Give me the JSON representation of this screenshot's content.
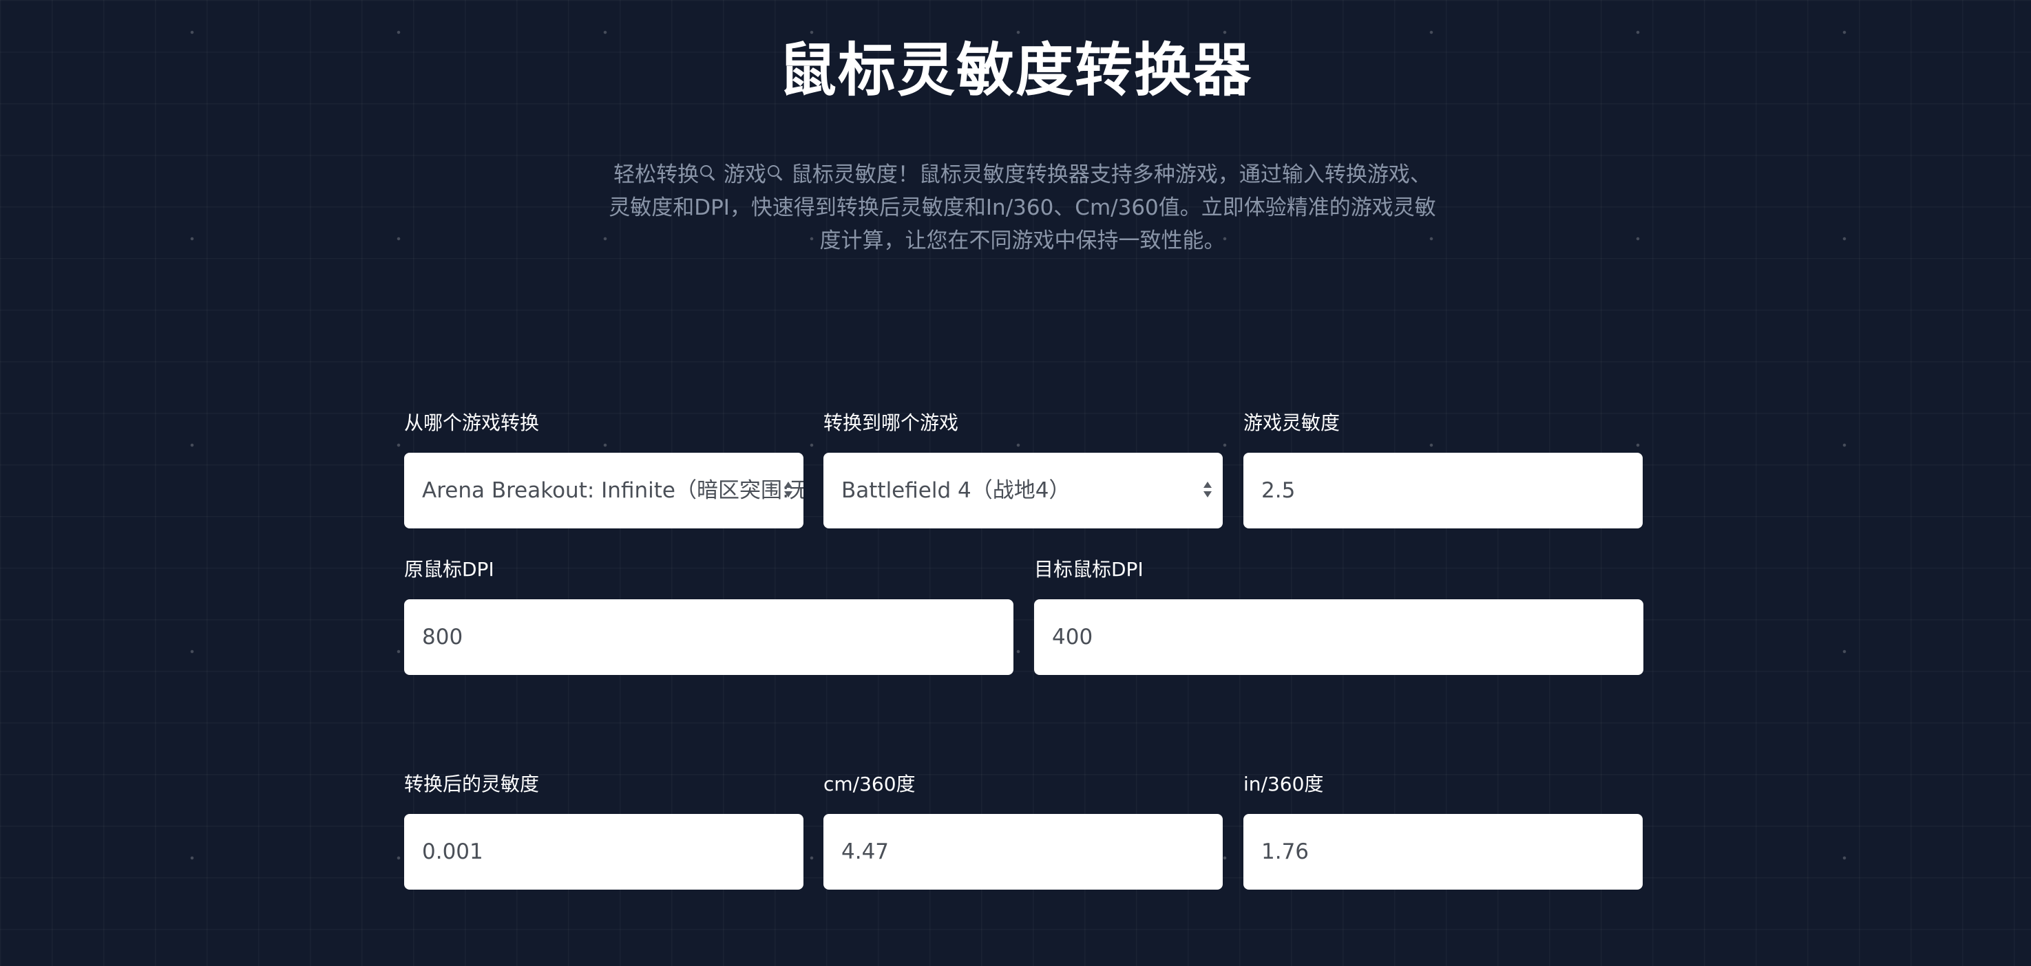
{
  "header": {
    "title": "鼠标灵敏度转换器",
    "description_parts": [
      "轻松转换",
      " 游戏",
      " 鼠标灵敏度！鼠标灵敏度转换器支持多种游戏，通过输入转换游戏、灵敏度和DPI，快速得到转换后灵敏度和In/360、Cm/360值。立即体验精准的游戏灵敏度计算，让您在不同游戏中保持一致性能。"
    ]
  },
  "form": {
    "from_game": {
      "label": "从哪个游戏转换",
      "value": "Arena Breakout: Infinite（暗区突围:无限）"
    },
    "to_game": {
      "label": "转换到哪个游戏",
      "value": "Battlefield 4（战地4）"
    },
    "sensitivity": {
      "label": "游戏灵敏度",
      "value": "2.5"
    },
    "source_dpi": {
      "label": "原鼠标DPI",
      "value": "800"
    },
    "target_dpi": {
      "label": "目标鼠标DPI",
      "value": "400"
    }
  },
  "results": {
    "converted_sensitivity": {
      "label": "转换后的灵敏度",
      "value": "0.001"
    },
    "cm_per_360": {
      "label": "cm/360度",
      "value": "4.47"
    },
    "in_per_360": {
      "label": "in/360度",
      "value": "1.76"
    }
  }
}
